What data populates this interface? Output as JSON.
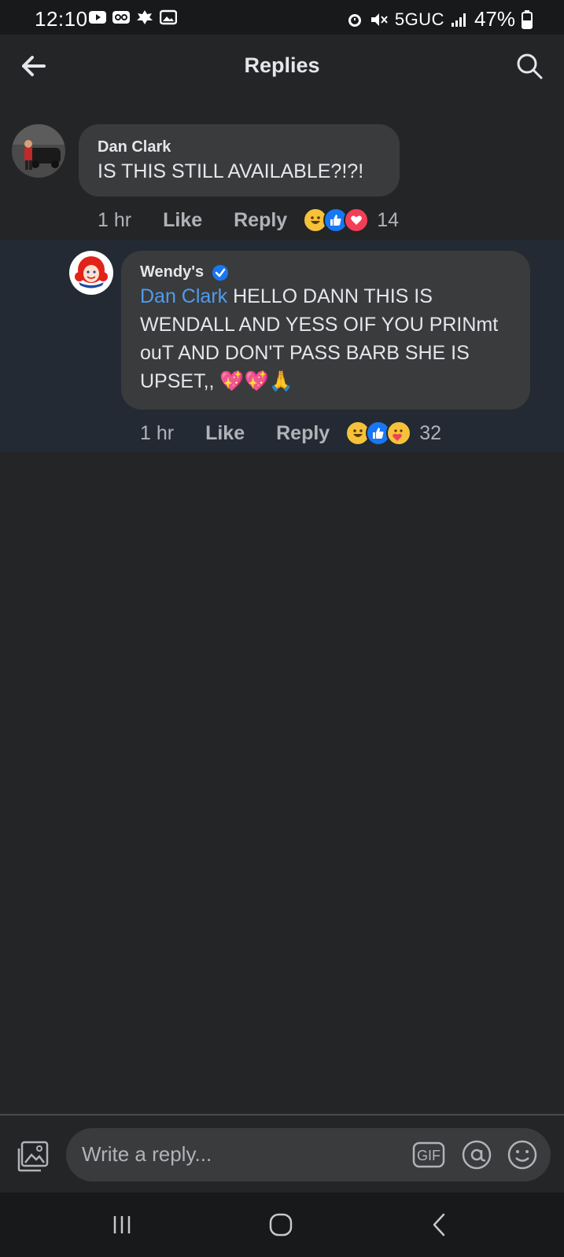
{
  "status": {
    "time": "12:10",
    "network": "5GUC",
    "battery": "47%"
  },
  "header": {
    "title": "Replies"
  },
  "comments": [
    {
      "author": "Dan Clark",
      "text": "IS THIS STILL AVAILABLE?!?!",
      "time": "1 hr",
      "like_label": "Like",
      "reply_label": "Reply",
      "reaction_count": "14",
      "reactions": [
        "haha",
        "like",
        "love"
      ]
    },
    {
      "author": "Wendy's",
      "verified": true,
      "mention": "Dan Clark",
      "text": "HELLO DANN THIS IS WENDALL AND YESS OIF YOU PRINmt ouT AND DON'T PASS BARB SHE IS UPSET,, 💖💖🙏",
      "time": "1 hr",
      "like_label": "Like",
      "reply_label": "Reply",
      "reaction_count": "32",
      "reactions": [
        "haha",
        "like",
        "care"
      ]
    }
  ],
  "composer": {
    "placeholder": "Write a reply...",
    "gif_label": "GIF"
  },
  "colors": {
    "background": "#242527",
    "bubble": "#3a3b3c",
    "mention": "#4f9cf0",
    "highlight_row": "#232a33"
  }
}
